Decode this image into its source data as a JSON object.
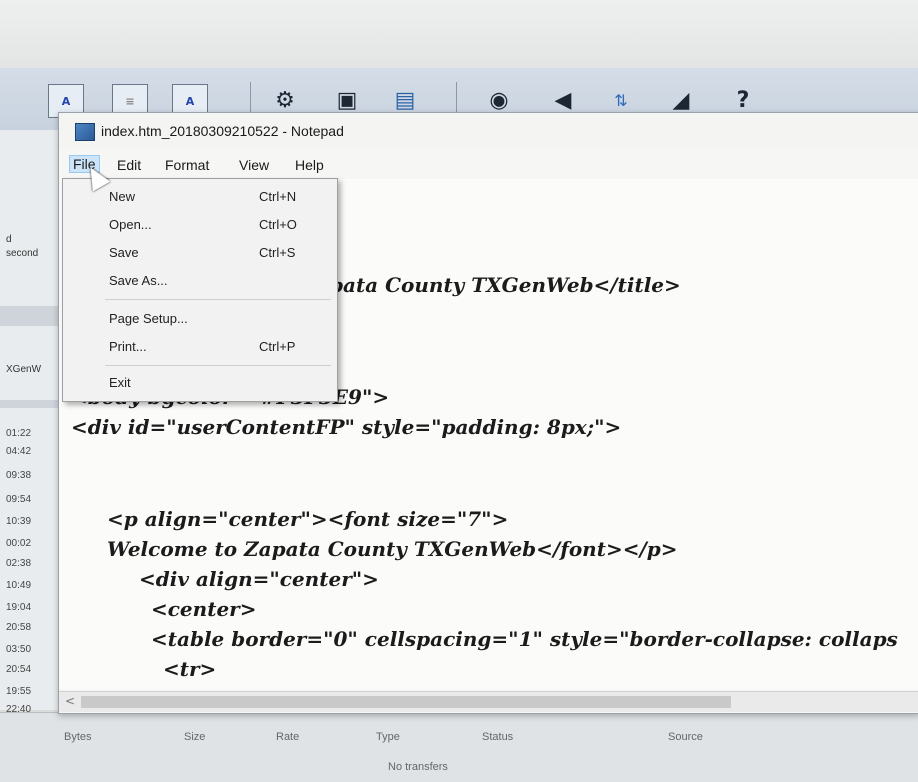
{
  "notepad": {
    "title": "index.htm_20180309210522 - Notepad",
    "menu": [
      "File",
      "Edit",
      "Format",
      "View",
      "Help"
    ],
    "active_menu": "File"
  },
  "file_menu": {
    "items": [
      {
        "label": "New",
        "shortcut": "Ctrl+N"
      },
      {
        "label": "Open...",
        "shortcut": "Ctrl+O"
      },
      {
        "label": "Save",
        "shortcut": "Ctrl+S"
      },
      {
        "label": "Save As...",
        "shortcut": ""
      },
      {
        "label": "Page Setup...",
        "shortcut": ""
      },
      {
        "label": "Print...",
        "shortcut": "Ctrl+P"
      },
      {
        "label": "Exit",
        "shortcut": ""
      }
    ]
  },
  "editor": {
    "lines": [
      "pata County TXGenWeb</title>",
      "<body bgcolor=\"#F3F3E9\">",
      "<div id=\"userContentFP\" style=\"padding: 8px;\">",
      "<p align=\"center\"><font size=\"7\">",
      "Welcome to Zapata County TXGenWeb</font></p>",
      "<div align=\"center\">",
      "<center>",
      "<table border=\"0\" cellspacing=\"1\" style=\"border-collapse: collaps",
      "<tr>"
    ]
  },
  "host_app": {
    "left_text": [
      "d",
      "second",
      "XGenW"
    ],
    "times": [
      "01:22",
      "04:42",
      "09:38",
      "09:54",
      "10:39",
      "00:02",
      "02:38",
      "10:49",
      "19:04",
      "20:58",
      "03:50",
      "20:54",
      "19:55",
      "22:40"
    ],
    "transfer_headers": [
      "Bytes",
      "Size",
      "Rate",
      "Type",
      "Status",
      "Source"
    ],
    "status": "No transfers"
  }
}
